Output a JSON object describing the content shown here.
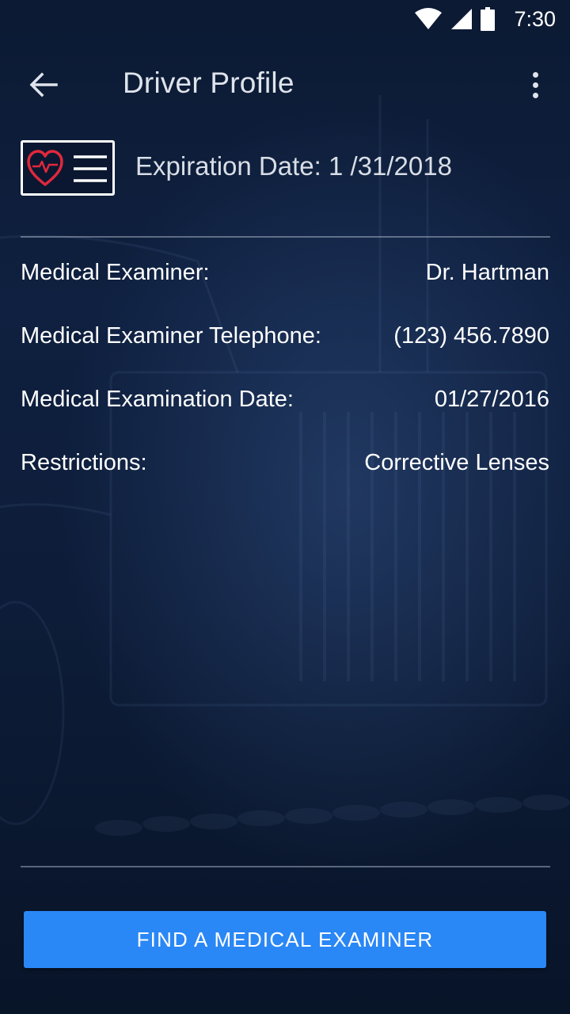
{
  "status_bar": {
    "time": "7:30",
    "icons": [
      "wifi-icon",
      "cell-signal-icon",
      "battery-icon"
    ]
  },
  "app_bar": {
    "title": "Driver Profile",
    "back_icon": "arrow-left-icon",
    "menu_icon": "more-vertical-icon"
  },
  "medical_card": {
    "icon": "medical-card-icon",
    "expiration_text": "Expiration Date: 1 /31/2018"
  },
  "details": [
    {
      "label": "Medical Examiner:",
      "value": "Dr. Hartman"
    },
    {
      "label": "Medical Examiner Telephone:",
      "value": "(123) 456.7890"
    },
    {
      "label": "Medical Examination Date:",
      "value": "01/27/2016"
    },
    {
      "label": "Restrictions:",
      "value": "Corrective Lenses"
    }
  ],
  "actions": {
    "find_examiner_label": "FIND A MEDICAL EXAMINER"
  },
  "colors": {
    "background": "#0f2040",
    "accent_button": "#2a87f6",
    "heart": "#e0283c"
  }
}
